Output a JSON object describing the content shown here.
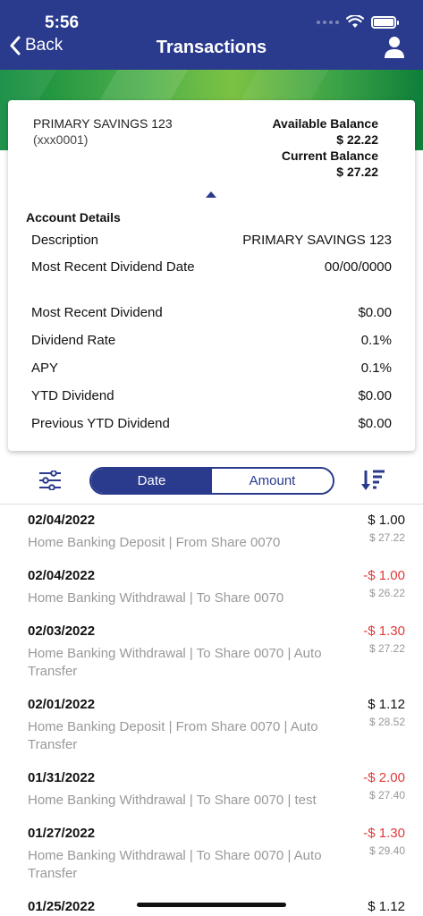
{
  "status": {
    "time": "5:56"
  },
  "nav": {
    "back_label": "Back",
    "title": "Transactions"
  },
  "account": {
    "name": "PRIMARY SAVINGS 123",
    "number": "(xxx0001)",
    "available_label": "Available Balance",
    "available_value": "$ 22.22",
    "current_label": "Current Balance",
    "current_value": "$ 27.22"
  },
  "details": {
    "title": "Account Details",
    "rows": [
      {
        "label": "Description",
        "value": "PRIMARY SAVINGS 123"
      },
      {
        "label": "Most Recent Dividend Date",
        "value": "00/00/0000"
      },
      {
        "label": "Most Recent Dividend",
        "value": "$0.00"
      },
      {
        "label": "Dividend Rate",
        "value": "0.1%"
      },
      {
        "label": "APY",
        "value": "0.1%"
      },
      {
        "label": "YTD Dividend",
        "value": "$0.00"
      },
      {
        "label": "Previous YTD Dividend",
        "value": "$0.00"
      }
    ]
  },
  "sort": {
    "options": [
      "Date",
      "Amount"
    ],
    "selected": "Date"
  },
  "transactions": [
    {
      "date": "02/04/2022",
      "description": "Home Banking Deposit | From Share 0070",
      "amount": "$ 1.00",
      "balance": "$ 27.22",
      "sign": "positive"
    },
    {
      "date": "02/04/2022",
      "description": "Home Banking Withdrawal | To Share 0070",
      "amount": "-$ 1.00",
      "balance": "$ 26.22",
      "sign": "negative"
    },
    {
      "date": "02/03/2022",
      "description": "Home Banking Withdrawal | To Share 0070 | Auto Transfer",
      "amount": "-$ 1.30",
      "balance": "$ 27.22",
      "sign": "negative"
    },
    {
      "date": "02/01/2022",
      "description": "Home Banking Deposit | From Share 0070 | Auto Transfer",
      "amount": "$ 1.12",
      "balance": "$ 28.52",
      "sign": "positive"
    },
    {
      "date": "01/31/2022",
      "description": "Home Banking Withdrawal | To Share 0070 | test",
      "amount": "-$ 2.00",
      "balance": "$ 27.40",
      "sign": "negative"
    },
    {
      "date": "01/27/2022",
      "description": "Home Banking Withdrawal | To Share 0070 | Auto Transfer",
      "amount": "-$ 1.30",
      "balance": "$ 29.40",
      "sign": "negative"
    },
    {
      "date": "01/25/2022",
      "description": "",
      "amount": "$ 1.12",
      "balance": "",
      "sign": "positive"
    }
  ],
  "colors": {
    "header": "#2a3a8c",
    "negative": "#e03a3a",
    "muted": "#999999"
  }
}
